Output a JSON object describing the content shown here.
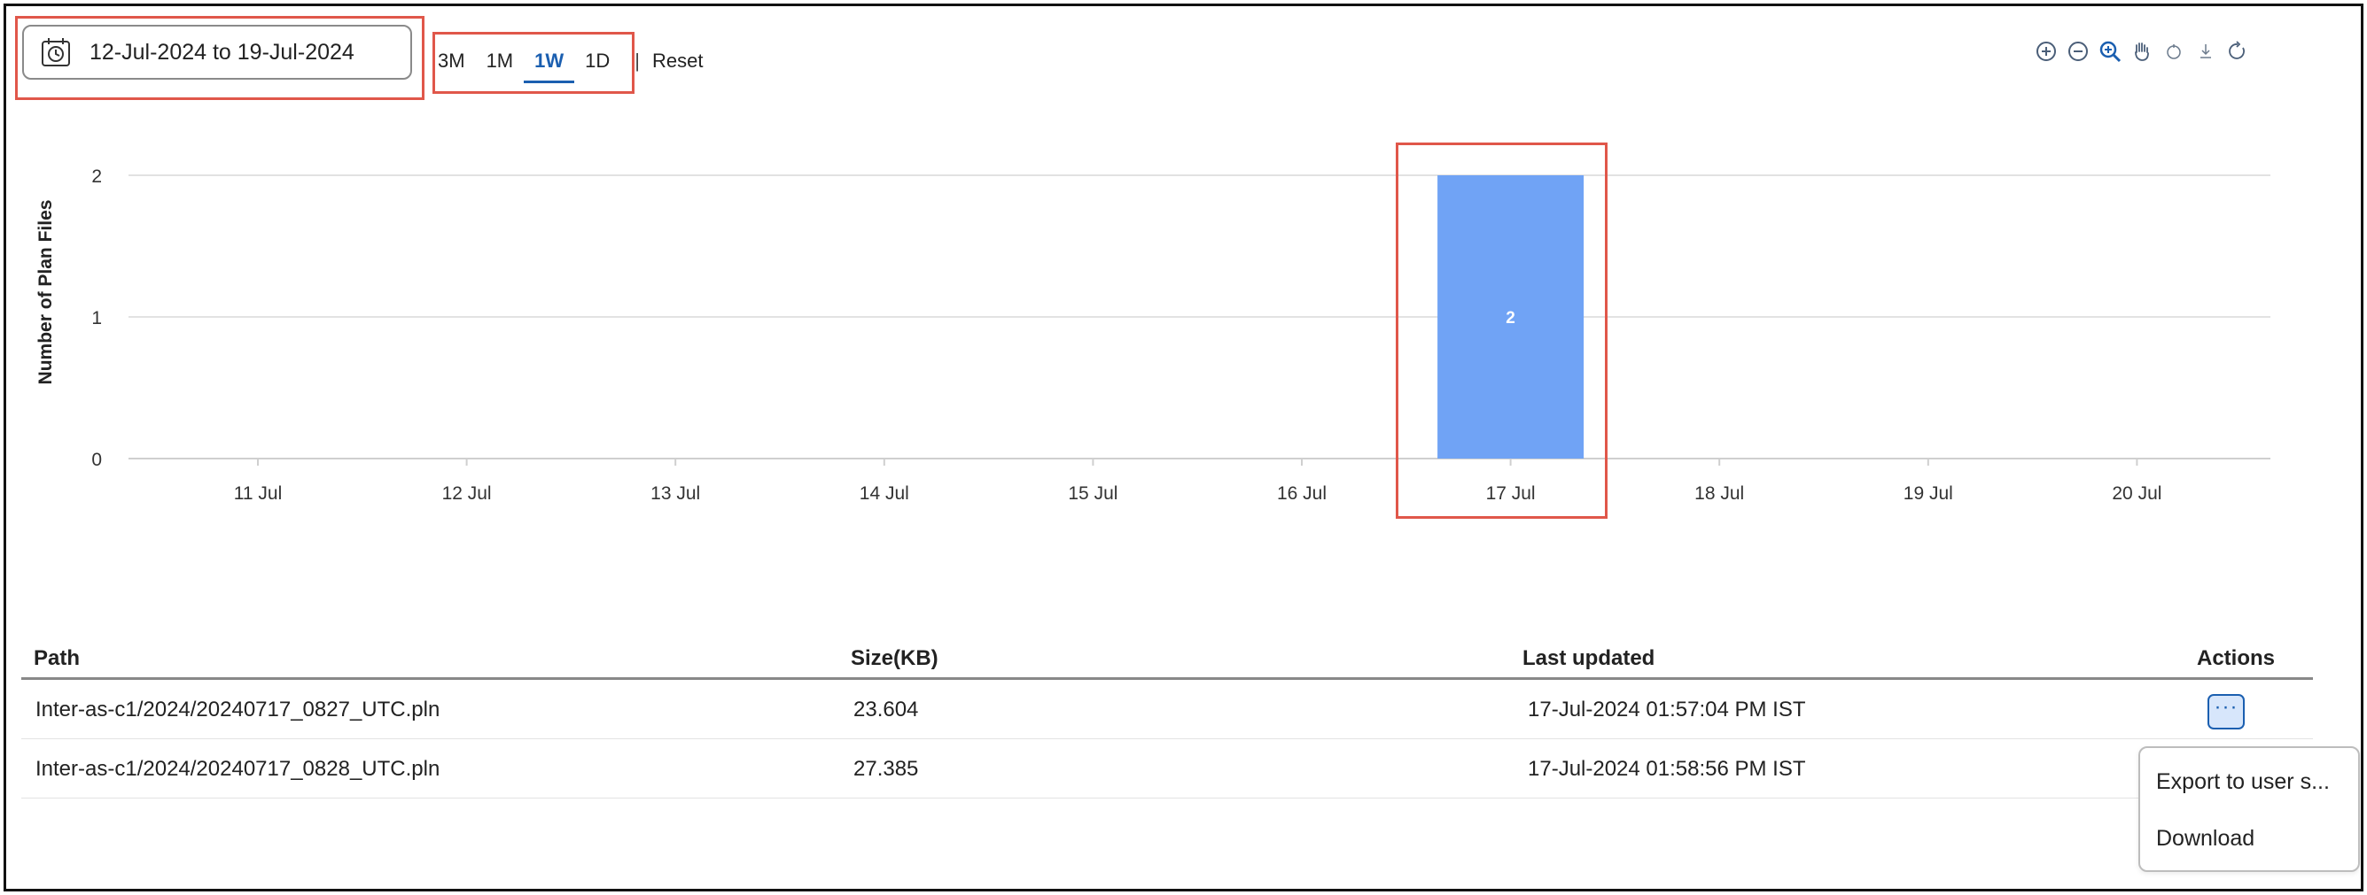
{
  "date_range": {
    "label": "12-Jul-2024 to 19-Jul-2024"
  },
  "range_buttons": [
    "3M",
    "1M",
    "1W",
    "1D"
  ],
  "active_range": "1W",
  "reset_label": "Reset",
  "chart_data": {
    "type": "bar",
    "categories": [
      "11 Jul",
      "12 Jul",
      "13 Jul",
      "14 Jul",
      "15 Jul",
      "16 Jul",
      "17 Jul",
      "18 Jul",
      "19 Jul",
      "20 Jul"
    ],
    "values": [
      0,
      0,
      0,
      0,
      0,
      0,
      2,
      0,
      0,
      0
    ],
    "ylabel": "Number of Plan Files",
    "xlabel": "",
    "ylim": [
      0,
      2
    ],
    "yticks": [
      "0",
      "1",
      "2"
    ],
    "bar_labels": [
      "",
      "",
      "",
      "",
      "",
      "",
      "2",
      "",
      "",
      ""
    ],
    "bar_color": "#70a3f5",
    "grid": true
  },
  "table": {
    "headers": {
      "path": "Path",
      "size": "Size(KB)",
      "updated": "Last updated",
      "actions": "Actions"
    },
    "rows": [
      {
        "path": "Inter-as-c1/2024/20240717_0827_UTC.pln",
        "size": "23.604",
        "updated": "17-Jul-2024 01:57:04 PM IST"
      },
      {
        "path": "Inter-as-c1/2024/20240717_0828_UTC.pln",
        "size": "27.385",
        "updated": "17-Jul-2024 01:58:56 PM IST"
      }
    ]
  },
  "actions_button": {
    "label": "···"
  },
  "menu": {
    "items": [
      "Export to user s...",
      "Download"
    ]
  },
  "colors": {
    "accent": "#1b5fb0",
    "bar": "#70a3f5",
    "highlight": "#e0574a"
  }
}
